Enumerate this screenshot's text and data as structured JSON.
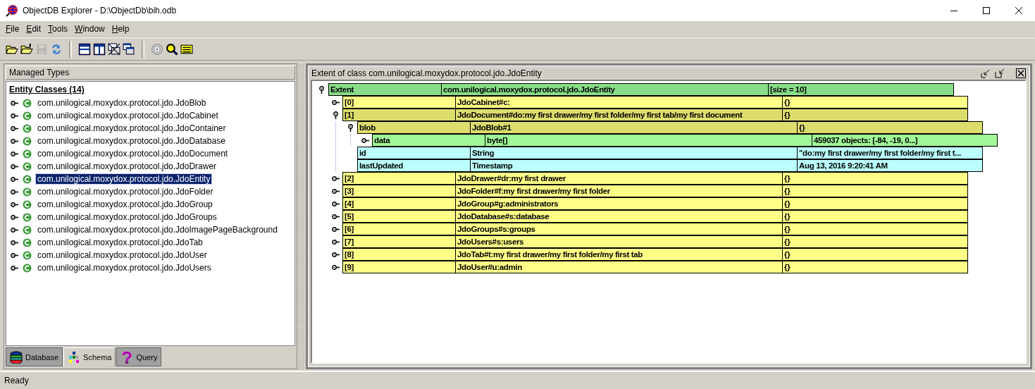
{
  "window": {
    "title": "ObjectDB Explorer - D:\\ObjectDb\\bih.odb"
  },
  "menu": [
    {
      "label": "File"
    },
    {
      "label": "Edit"
    },
    {
      "label": "Tools"
    },
    {
      "label": "Window"
    },
    {
      "label": "Help"
    }
  ],
  "toolbar": [
    {
      "kind": "open",
      "disabled": false
    },
    {
      "kind": "open-remote",
      "disabled": false
    },
    {
      "kind": "save",
      "disabled": true
    },
    {
      "kind": "refresh",
      "disabled": false
    },
    {
      "kind": "separator"
    },
    {
      "kind": "split-h",
      "disabled": false
    },
    {
      "kind": "split-v",
      "disabled": false
    },
    {
      "kind": "close-all",
      "disabled": false
    },
    {
      "kind": "cascade",
      "disabled": false
    },
    {
      "kind": "separator"
    },
    {
      "kind": "target",
      "disabled": false
    },
    {
      "kind": "search",
      "disabled": false
    },
    {
      "kind": "table",
      "disabled": false
    }
  ],
  "left_panel": {
    "title": "Managed Types",
    "group": "Entity Classes (14)",
    "classes": [
      {
        "label": "com.unilogical.moxydox.protocol.jdo.JdoBlob",
        "selected": false
      },
      {
        "label": "com.unilogical.moxydox.protocol.jdo.JdoCabinet",
        "selected": false
      },
      {
        "label": "com.unilogical.moxydox.protocol.jdo.JdoContainer",
        "selected": false
      },
      {
        "label": "com.unilogical.moxydox.protocol.jdo.JdoDatabase",
        "selected": false
      },
      {
        "label": "com.unilogical.moxydox.protocol.jdo.JdoDocument",
        "selected": false
      },
      {
        "label": "com.unilogical.moxydox.protocol.jdo.JdoDrawer",
        "selected": false
      },
      {
        "label": "com.unilogical.moxydox.protocol.jdo.JdoEntity",
        "selected": true
      },
      {
        "label": "com.unilogical.moxydox.protocol.jdo.JdoFolder",
        "selected": false
      },
      {
        "label": "com.unilogical.moxydox.protocol.jdo.JdoGroup",
        "selected": false
      },
      {
        "label": "com.unilogical.moxydox.protocol.jdo.JdoGroups",
        "selected": false
      },
      {
        "label": "com.unilogical.moxydox.protocol.jdo.JdoImagePageBackground",
        "selected": false
      },
      {
        "label": "com.unilogical.moxydox.protocol.jdo.JdoTab",
        "selected": false
      },
      {
        "label": "com.unilogical.moxydox.protocol.jdo.JdoUser",
        "selected": false
      },
      {
        "label": "com.unilogical.moxydox.protocol.jdo.JdoUsers",
        "selected": false
      }
    ],
    "tabs": [
      {
        "label": "Database",
        "kind": "database",
        "selected": false
      },
      {
        "label": "Schema",
        "kind": "schema",
        "selected": true
      },
      {
        "label": "Query",
        "kind": "query",
        "selected": false
      }
    ]
  },
  "extent_window": {
    "title": "Extent of class com.unilogical.moxydox.protocol.jdo.JdoEntity",
    "tree": [
      {
        "kind": "extent",
        "expanded": true,
        "name": "Extent",
        "type": "com.unilogical.moxydox.protocol.jdo.JdoEntity",
        "value": "[size = 10]",
        "children": [
          {
            "kind": "entity",
            "expanded": false,
            "name": "[0]",
            "type": "JdoCabinet#c:",
            "value": "{}"
          },
          {
            "kind": "entity",
            "expanded": true,
            "name": "[1]",
            "type": "JdoDocument#do:my first drawer/my first folder/my first tab/my first document",
            "value": "{}",
            "children": [
              {
                "kind": "entity",
                "expanded": true,
                "name": "blob",
                "type": "JdoBlob#1",
                "value": "{}",
                "children": [
                  {
                    "kind": "array",
                    "expanded": false,
                    "name": "data",
                    "type": "byte[]",
                    "value": "459037 objects: [-84, -19, 0...]"
                  }
                ]
              },
              {
                "kind": "field",
                "name": "id",
                "type": "String",
                "value": "\"do:my first drawer/my first folder/my first t..."
              },
              {
                "kind": "field",
                "name": "lastUpdated",
                "type": "Timestamp",
                "value": "Aug 13, 2016 9:20:41 AM"
              }
            ]
          },
          {
            "kind": "entity",
            "expanded": false,
            "name": "[2]",
            "type": "JdoDrawer#dr:my first drawer",
            "value": "{}"
          },
          {
            "kind": "entity",
            "expanded": false,
            "name": "[3]",
            "type": "JdoFolder#f:my first drawer/my first folder",
            "value": "{}"
          },
          {
            "kind": "entity",
            "expanded": false,
            "name": "[4]",
            "type": "JdoGroup#g:administrators",
            "value": "{}"
          },
          {
            "kind": "entity",
            "expanded": false,
            "name": "[5]",
            "type": "JdoDatabase#s:database",
            "value": "{}"
          },
          {
            "kind": "entity",
            "expanded": false,
            "name": "[6]",
            "type": "JdoGroups#s:groups",
            "value": "{}"
          },
          {
            "kind": "entity",
            "expanded": false,
            "name": "[7]",
            "type": "JdoUsers#s:users",
            "value": "{}"
          },
          {
            "kind": "entity",
            "expanded": false,
            "name": "[8]",
            "type": "JdoTab#t:my first drawer/my first folder/my first tab",
            "value": "{}"
          },
          {
            "kind": "entity",
            "expanded": false,
            "name": "[9]",
            "type": "JdoUser#u:admin",
            "value": "{}"
          }
        ]
      }
    ]
  },
  "status_bar": {
    "text": "Ready"
  }
}
